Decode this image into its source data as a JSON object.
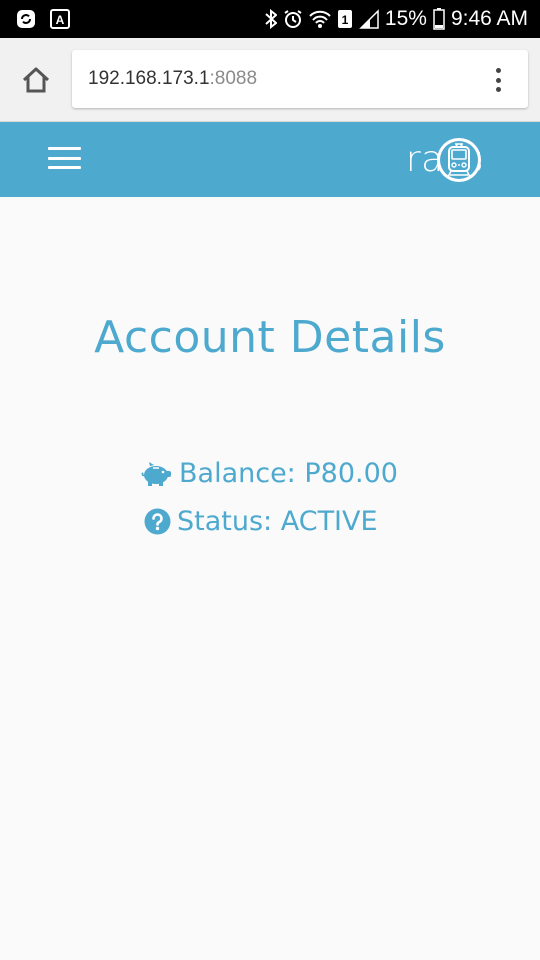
{
  "status_bar": {
    "battery": "15%",
    "time": "9:46 AM",
    "sim_slot": "1"
  },
  "browser": {
    "url_host": "192.168.173.1",
    "url_port": ":8088"
  },
  "header": {
    "brand": "rails",
    "accent_color": "#4ea9cf"
  },
  "main": {
    "title": "Account Details",
    "balance": "Balance: P80.00",
    "status": "Status: ACTIVE"
  }
}
